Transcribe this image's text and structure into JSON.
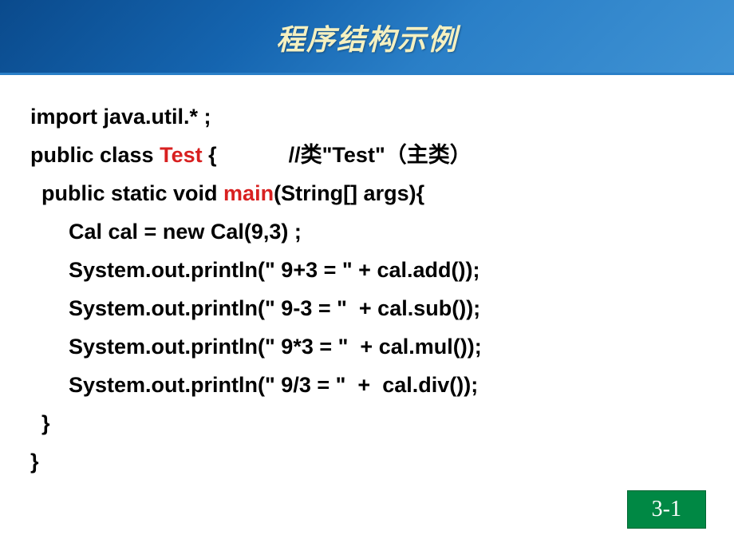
{
  "header": {
    "title": "程序结构示例"
  },
  "code": {
    "line1": "import java.util.* ;",
    "line2_prefix": "public class ",
    "line2_keyword": "Test",
    "line2_suffix": " {            ",
    "line2_comment": "//类\"Test\"（主类）",
    "line3_prefix": "public static void ",
    "line3_keyword": "main",
    "line3_suffix": "(String[] args){",
    "line4": "Cal cal = new Cal(9,3) ;",
    "line5": "System.out.println(\" 9+3 = \" + cal.add());",
    "line6": "System.out.println(\" 9-3 = \"  + cal.sub());",
    "line7": "System.out.println(\" 9*3 = \"  + cal.mul());",
    "line8": "System.out.println(\" 9/3 = \"  +  cal.div());",
    "line9": "}",
    "line10": "}"
  },
  "page": {
    "number": "3-1"
  }
}
